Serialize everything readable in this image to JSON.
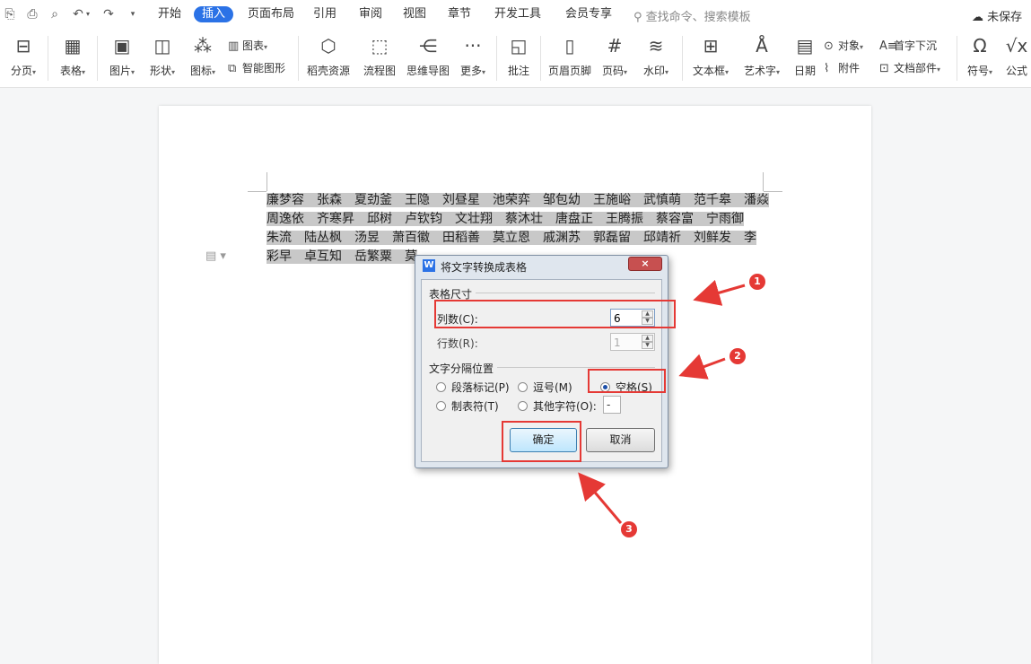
{
  "menubar": {
    "tabs": [
      "开始",
      "插入",
      "页面布局",
      "引用",
      "审阅",
      "视图",
      "章节",
      "开发工具",
      "会员专享"
    ],
    "active_tab": "插入",
    "search_placeholder": "查找命令、搜索模板",
    "unsaved_label": "未保存"
  },
  "ribbon": {
    "page_break": "分页",
    "table": "表格",
    "picture": "图片",
    "shape": "形状",
    "icon": "图标",
    "chart": "图表",
    "smart_shape": "智能图形",
    "docer_resources": "稻壳资源",
    "flowchart": "流程图",
    "mindmap": "思维导图",
    "more": "更多",
    "comment": "批注",
    "header_footer": "页眉页脚",
    "page_number": "页码",
    "watermark": "水印",
    "textbox": "文本框",
    "wordart": "艺术字",
    "date": "日期",
    "object": "对象",
    "attachment": "附件",
    "drop_cap": "首字下沉",
    "doc_parts": "文档部件",
    "symbol": "符号",
    "formula": "公式"
  },
  "document": {
    "lines": [
      "廉梦容　张森　夏劲釜　王隐　刘昼星　池荣弈　邹包幼　王施峪　武慎萌　范千皋　潘焱",
      "周逸依　齐寒昇　邱树　卢钦钧　文壮翔　蔡沐壮　唐盘正　王腾振　蔡容富　宁雨御",
      "朱流　陆丛枫　汤昱　萧百徽　田稻善　莫立恩　戚渊苏　郭磊留　邱靖祈　刘鲜发　李",
      "彩早　卓互知　岳繁粟　莫"
    ]
  },
  "dialog": {
    "title": "将文字转换成表格",
    "close_label": "×",
    "table_size_group": "表格尺寸",
    "columns_label": "列数(C):",
    "columns_value": "6",
    "rows_label": "行数(R):",
    "rows_value": "1",
    "separator_group": "文字分隔位置",
    "options": {
      "paragraph": "段落标记(P)",
      "comma": "逗号(M)",
      "space": "空格(S)",
      "tab": "制表符(T)",
      "other": "其他字符(O):"
    },
    "selected_option": "space",
    "other_char_value": "-",
    "ok_label": "确定",
    "cancel_label": "取消"
  },
  "annotations": {
    "badges": [
      "1",
      "2",
      "3"
    ],
    "color": "#e53935"
  },
  "colors": {
    "accent": "#2b72e6",
    "selection": "#c8c8c8"
  }
}
